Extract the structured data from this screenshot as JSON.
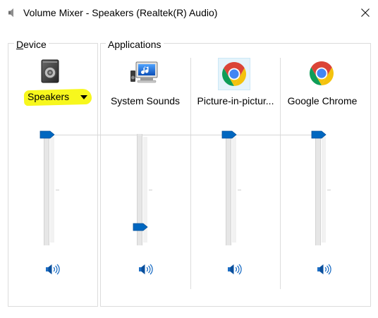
{
  "window": {
    "title": "Volume Mixer - Speakers (Realtek(R) Audio)",
    "title_icon": "speaker-icon",
    "close_icon": "close-icon"
  },
  "device_group": {
    "label_mnemonic": "D",
    "label_rest": "evice",
    "device_name": "Speakers",
    "icon": "speaker-device-icon",
    "highlight_color": "#f7f71d",
    "volume_fraction": 1.0
  },
  "applications_group": {
    "label": "Applications",
    "apps": [
      {
        "name": "System Sounds",
        "icon": "system-sounds-icon",
        "volume_fraction": 0.1
      },
      {
        "name": "Picture-in-pictur...",
        "icon": "chrome-icon",
        "volume_fraction": 1.0
      },
      {
        "name": "Google Chrome",
        "icon": "chrome-icon",
        "volume_fraction": 1.0
      }
    ]
  },
  "colors": {
    "slider_thumb": "#0067c0",
    "border": "#dcdcdc",
    "chrome_red": "#db4437",
    "chrome_yellow": "#f4c20d",
    "chrome_green": "#0f9d58",
    "chrome_blue": "#4285f4"
  }
}
